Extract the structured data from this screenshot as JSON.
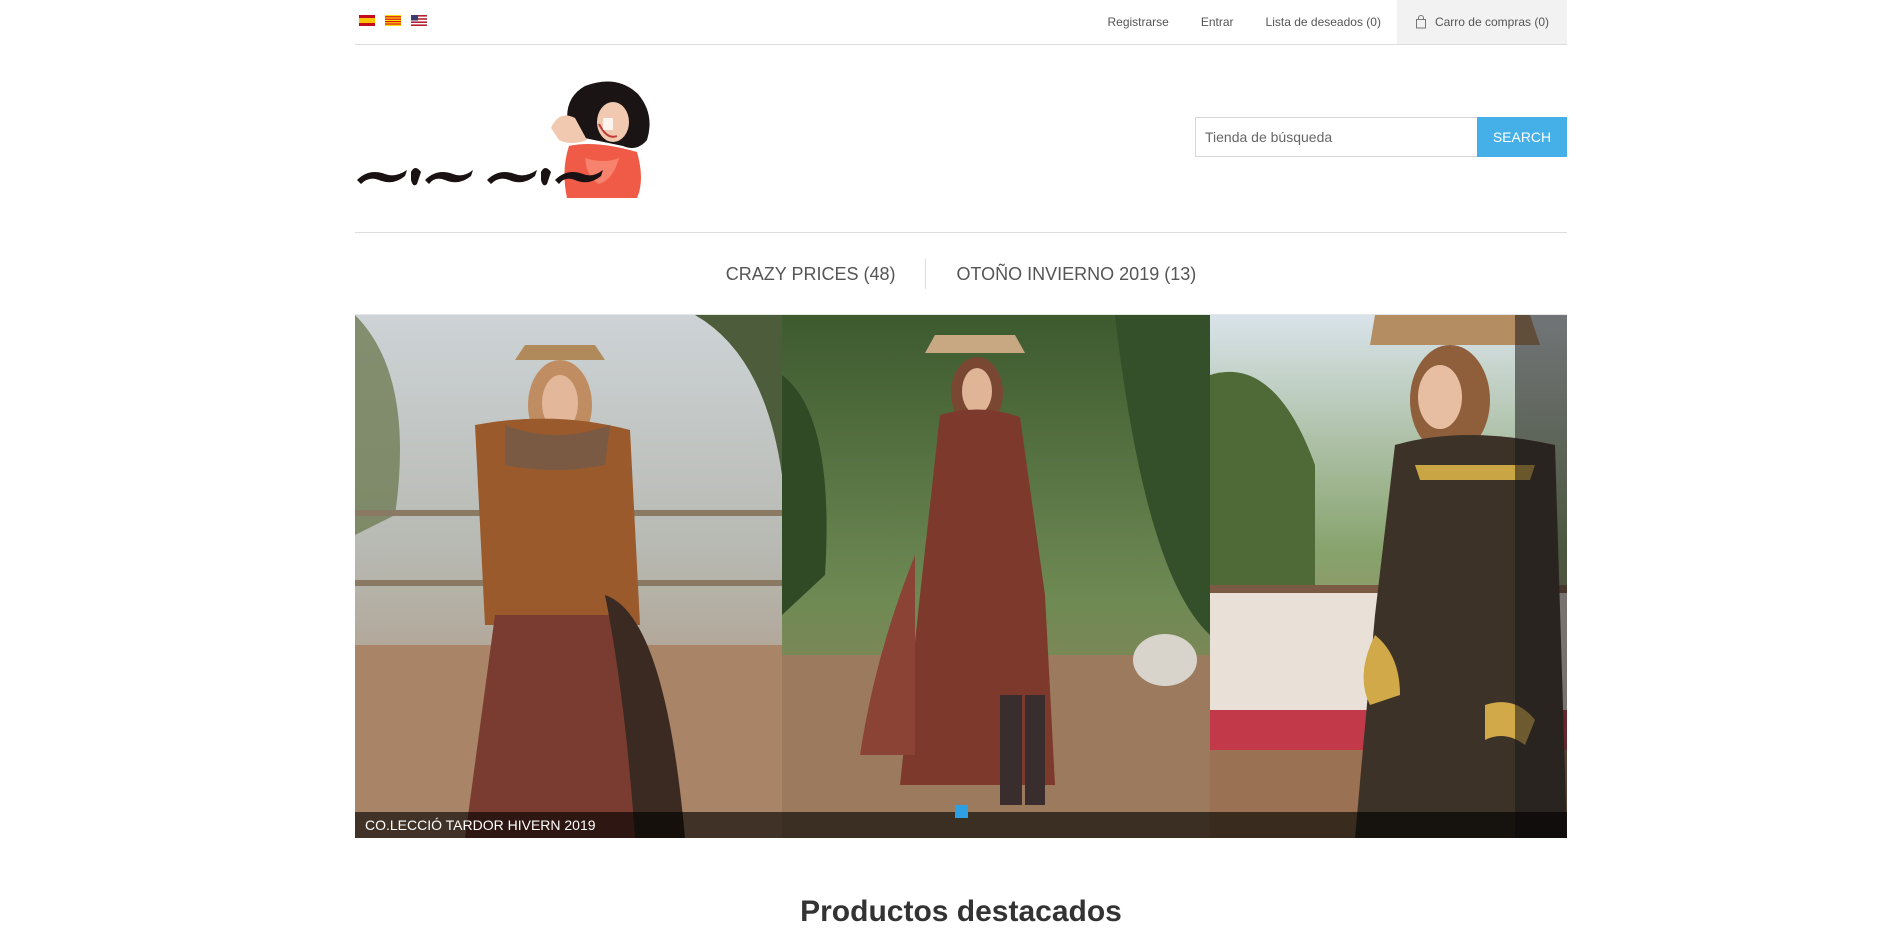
{
  "header": {
    "languages": [
      "Español",
      "Català",
      "English"
    ],
    "register_label": "Registrarse",
    "login_label": "Entrar",
    "wishlist_label": "Lista de deseados (0)",
    "cart_label": "Carro de compras (0)"
  },
  "logo": {
    "text": "sis sis"
  },
  "search": {
    "placeholder": "Tienda de búsqueda",
    "button_label": "SEARCH"
  },
  "nav": {
    "items": [
      "CRAZY PRICES (48)",
      "OTOÑO INVIERNO 2019 (13)"
    ]
  },
  "slider": {
    "caption": "CO.LECCIÓ TARDOR HIVERN 2019",
    "active_slide": 1
  },
  "section": {
    "title": "Productos destacados"
  },
  "colors": {
    "accent": "#45b0e8",
    "dot": "#2f9fe3"
  }
}
